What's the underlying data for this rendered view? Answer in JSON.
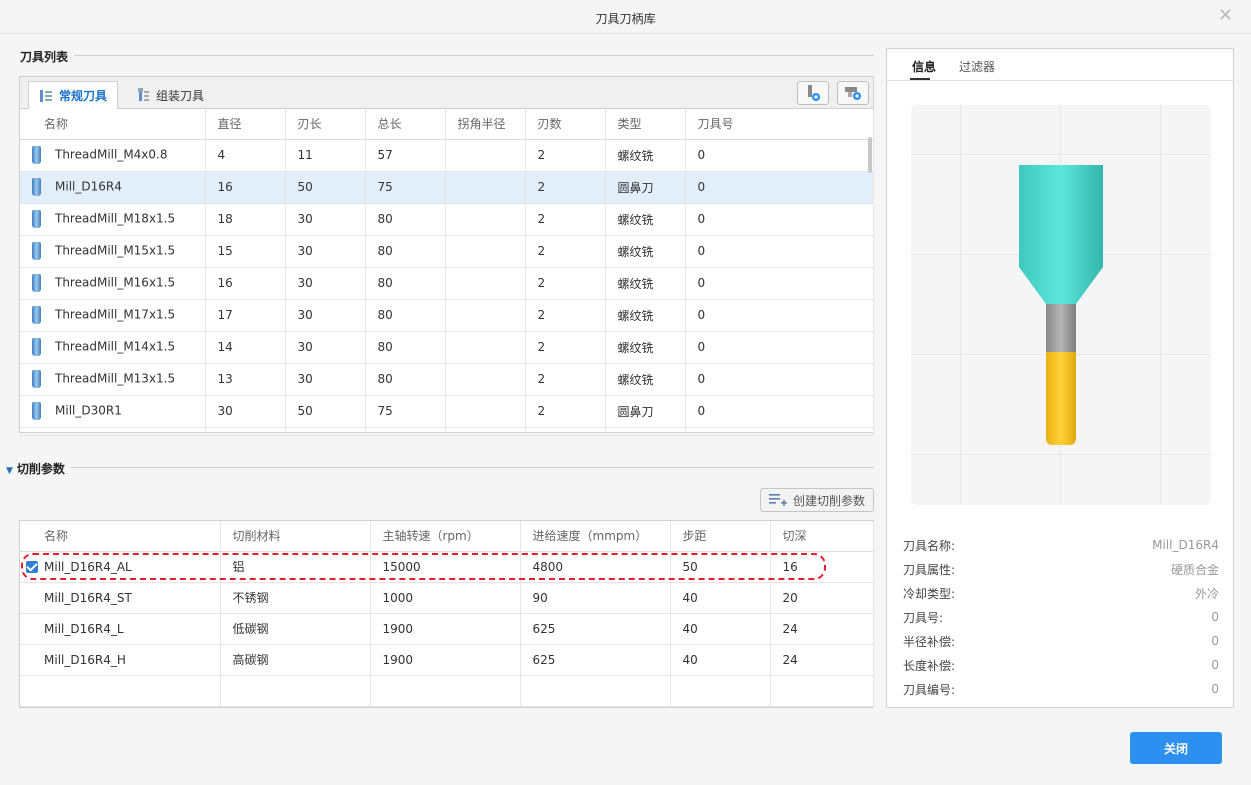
{
  "window": {
    "title": "刀具刀柄库",
    "close_glyph": "✕"
  },
  "tool_list": {
    "section_title": "刀具列表",
    "tabs": [
      {
        "label": "常规刀具",
        "active": true
      },
      {
        "label": "组装刀具",
        "active": false
      }
    ],
    "columns": [
      "名称",
      "直径",
      "刃长",
      "总长",
      "拐角半径",
      "刃数",
      "类型",
      "刀具号"
    ],
    "rows": [
      {
        "name": "ThreadMill_M4x0.8",
        "diameter": "4",
        "flute_len": "11",
        "total_len": "57",
        "corner_r": "",
        "flutes": "2",
        "type": "螺纹铣",
        "tool_no": "0"
      },
      {
        "name": "Mill_D16R4",
        "diameter": "16",
        "flute_len": "50",
        "total_len": "75",
        "corner_r": "",
        "flutes": "2",
        "type": "圆鼻刀",
        "tool_no": "0"
      },
      {
        "name": "ThreadMill_M18x1.5",
        "diameter": "18",
        "flute_len": "30",
        "total_len": "80",
        "corner_r": "",
        "flutes": "2",
        "type": "螺纹铣",
        "tool_no": "0"
      },
      {
        "name": "ThreadMill_M15x1.5",
        "diameter": "15",
        "flute_len": "30",
        "total_len": "80",
        "corner_r": "",
        "flutes": "2",
        "type": "螺纹铣",
        "tool_no": "0"
      },
      {
        "name": "ThreadMill_M16x1.5",
        "diameter": "16",
        "flute_len": "30",
        "total_len": "80",
        "corner_r": "",
        "flutes": "2",
        "type": "螺纹铣",
        "tool_no": "0"
      },
      {
        "name": "ThreadMill_M17x1.5",
        "diameter": "17",
        "flute_len": "30",
        "total_len": "80",
        "corner_r": "",
        "flutes": "2",
        "type": "螺纹铣",
        "tool_no": "0"
      },
      {
        "name": "ThreadMill_M14x1.5",
        "diameter": "14",
        "flute_len": "30",
        "total_len": "80",
        "corner_r": "",
        "flutes": "2",
        "type": "螺纹铣",
        "tool_no": "0"
      },
      {
        "name": "ThreadMill_M13x1.5",
        "diameter": "13",
        "flute_len": "30",
        "total_len": "80",
        "corner_r": "",
        "flutes": "2",
        "type": "螺纹铣",
        "tool_no": "0"
      },
      {
        "name": "Mill_D30R1",
        "diameter": "30",
        "flute_len": "50",
        "total_len": "75",
        "corner_r": "",
        "flutes": "2",
        "type": "圆鼻刀",
        "tool_no": "0"
      }
    ],
    "selected_index": 1
  },
  "cutting": {
    "section_title": "切削参数",
    "create_label": "创建切削参数",
    "columns": [
      "名称",
      "切削材料",
      "主轴转速（rpm）",
      "进给速度（mmpm）",
      "步距",
      "切深"
    ],
    "rows": [
      {
        "name": "Mill_D16R4_AL",
        "material": "铝",
        "spindle": "15000",
        "feed": "4800",
        "step": "50",
        "depth": "16",
        "checked": true
      },
      {
        "name": "Mill_D16R4_ST",
        "material": "不锈钢",
        "spindle": "1000",
        "feed": "90",
        "step": "40",
        "depth": "20",
        "checked": false
      },
      {
        "name": "Mill_D16R4_L",
        "material": "低碳钢",
        "spindle": "1900",
        "feed": "625",
        "step": "40",
        "depth": "24",
        "checked": false
      },
      {
        "name": "Mill_D16R4_H",
        "material": "高碳钢",
        "spindle": "1900",
        "feed": "625",
        "step": "40",
        "depth": "24",
        "checked": false
      }
    ]
  },
  "info": {
    "tabs": [
      "信息",
      "过滤器"
    ],
    "props": [
      {
        "k": "刀具名称:",
        "v": "Mill_D16R4"
      },
      {
        "k": "刀具属性:",
        "v": "硬质合金"
      },
      {
        "k": "冷却类型:",
        "v": "外冷"
      },
      {
        "k": "刀具号:",
        "v": "0"
      },
      {
        "k": "半径补偿:",
        "v": "0"
      },
      {
        "k": "长度补偿:",
        "v": "0"
      },
      {
        "k": "刀具编号:",
        "v": "0"
      }
    ],
    "colors": {
      "holder": "#4ed8cc",
      "shank": "#9e9e9e",
      "blade": "#f4c21c"
    }
  },
  "footer": {
    "close_label": "关闭"
  },
  "colors": {
    "accent": "#2d8ff0",
    "selected_row": "#e3eefb",
    "highlight": "#e0202a"
  }
}
